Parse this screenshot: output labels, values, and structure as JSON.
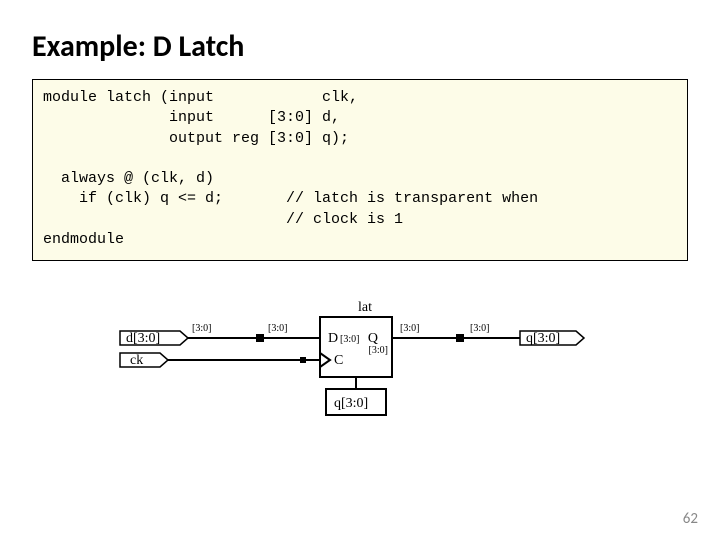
{
  "title": "Example: D Latch",
  "code": "module latch (input            clk,\n              input      [3:0] d,\n              output reg [3:0] q);\n\n  always @ (clk, d)\n    if (clk) q <= d;       // latch is transparent when\n                           // clock is 1\nendmodule",
  "diagram": {
    "block_label": "lat",
    "left_d": "d[3:0]",
    "left_ck": "ck",
    "wire_d_left": "[3:0]",
    "wire_d_right": "[3:0]",
    "port_D": "D",
    "port_D_bus": "[3:0]",
    "port_C": "C",
    "port_Q": "Q",
    "port_Q_bus": "[3:0]",
    "wire_q_left": "[3:0]",
    "wire_q_right": "[3:0]",
    "right_q": "q[3:0]",
    "bottom_bus": "q[3:0]"
  },
  "page_number": "62"
}
